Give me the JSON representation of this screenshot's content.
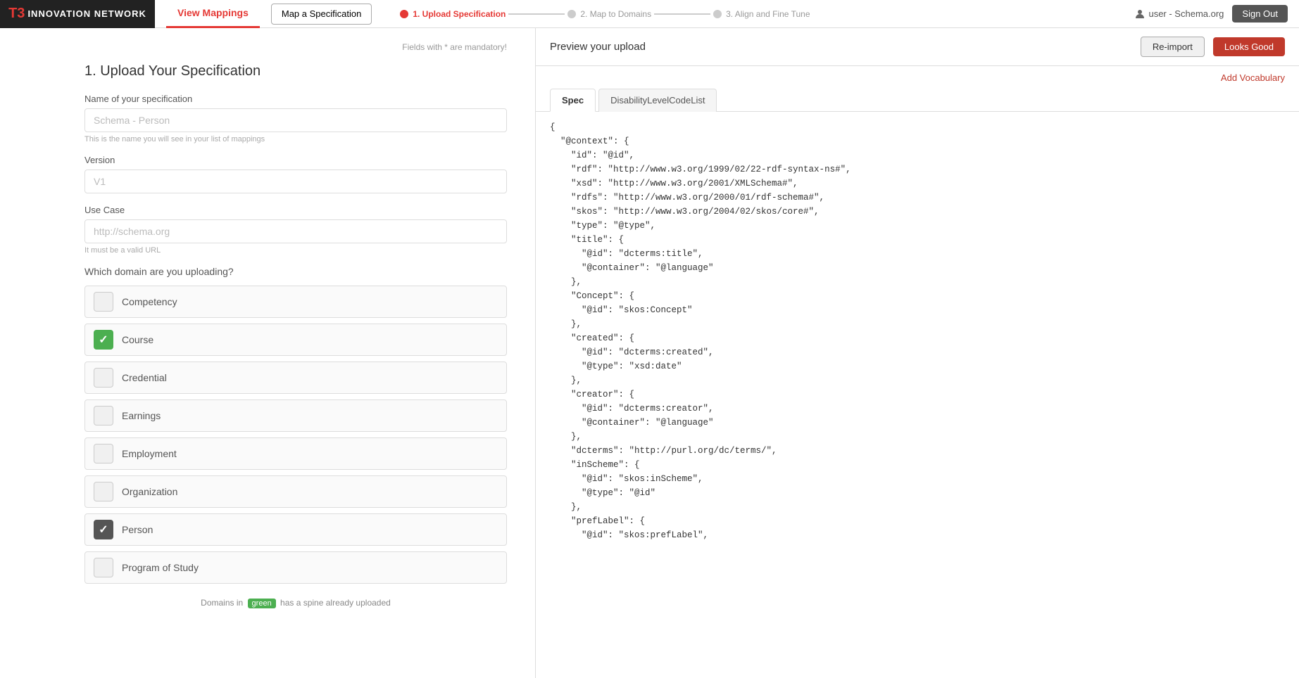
{
  "header": {
    "logo_t3": "T3",
    "logo_sub": "INNOVATION NETWORK",
    "nav_view_mappings": "View Mappings",
    "nav_map_spec": "Map a Specification",
    "step1_label": "1. Upload Specification",
    "step2_label": "2. Map to Domains",
    "step3_label": "3. Align and Fine Tune",
    "user_label": "user - Schema.org",
    "sign_out": "Sign Out"
  },
  "form": {
    "section_title": "1. Upload Your Specification",
    "mandatory_note": "Fields with * are mandatory!",
    "name_label": "Name of your specification",
    "name_placeholder": "Schema - Person",
    "name_hint": "This is the name you will see in your list of mappings",
    "version_label": "Version",
    "version_placeholder": "V1",
    "use_case_label": "Use Case",
    "use_case_placeholder": "http://schema.org",
    "use_case_hint": "It must be a valid URL",
    "domain_label": "Which domain are you uploading?",
    "bottom_note_prefix": "Domains in",
    "bottom_note_badge": "green",
    "bottom_note_suffix": "has a spine already uploaded",
    "domains": [
      {
        "id": "competency",
        "label": "Competency",
        "state": "unchecked"
      },
      {
        "id": "course",
        "label": "Course",
        "state": "green"
      },
      {
        "id": "credential",
        "label": "Credential",
        "state": "unchecked"
      },
      {
        "id": "earnings",
        "label": "Earnings",
        "state": "unchecked"
      },
      {
        "id": "employment",
        "label": "Employment",
        "state": "unchecked"
      },
      {
        "id": "organization",
        "label": "Organization",
        "state": "unchecked"
      },
      {
        "id": "person",
        "label": "Person",
        "state": "dark"
      },
      {
        "id": "program-of-study",
        "label": "Program of Study",
        "state": "unchecked"
      }
    ]
  },
  "preview": {
    "title": "Preview your upload",
    "re_import": "Re-import",
    "looks_good": "Looks Good",
    "add_vocab": "Add Vocabulary",
    "tabs": [
      {
        "id": "spec",
        "label": "Spec",
        "active": true
      },
      {
        "id": "disability",
        "label": "DisabilityLevelCodeList",
        "active": false
      }
    ],
    "code": "{\n  \"@context\": {\n    \"id\": \"@id\",\n    \"rdf\": \"http://www.w3.org/1999/02/22-rdf-syntax-ns#\",\n    \"xsd\": \"http://www.w3.org/2001/XMLSchema#\",\n    \"rdfs\": \"http://www.w3.org/2000/01/rdf-schema#\",\n    \"skos\": \"http://www.w3.org/2004/02/skos/core#\",\n    \"type\": \"@type\",\n    \"title\": {\n      \"@id\": \"dcterms:title\",\n      \"@container\": \"@language\"\n    },\n    \"Concept\": {\n      \"@id\": \"skos:Concept\"\n    },\n    \"created\": {\n      \"@id\": \"dcterms:created\",\n      \"@type\": \"xsd:date\"\n    },\n    \"creator\": {\n      \"@id\": \"dcterms:creator\",\n      \"@container\": \"@language\"\n    },\n    \"dcterms\": \"http://purl.org/dc/terms/\",\n    \"inScheme\": {\n      \"@id\": \"skos:inScheme\",\n      \"@type\": \"@id\"\n    },\n    \"prefLabel\": {\n      \"@id\": \"skos:prefLabel\","
  }
}
